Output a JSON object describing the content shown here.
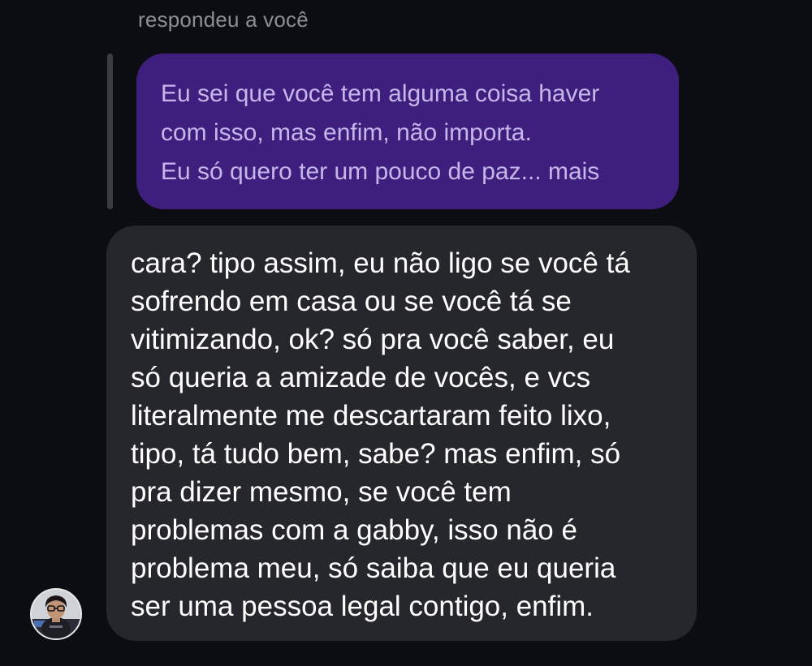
{
  "reply_context": {
    "header": "respondeu a você",
    "quoted_lines": [
      "Eu sei que você tem alguma coisa haver",
      "com isso, mas enfim, não importa.",
      "Eu só quero ter um pouco de paz... mais"
    ]
  },
  "message": {
    "lines": [
      "cara? tipo assim, eu não ligo se você tá",
      "sofrendo em casa ou se você tá se",
      "vitimizando, ok? só pra você saber, eu",
      "só queria a amizade de vocês, e vcs",
      "literalmente me descartaram feito lixo,",
      "tipo, tá tudo bem, sabe? mas enfim, só",
      "pra dizer mesmo, se você tem",
      "problemas com a gabby, isso não é",
      "problema meu, só saiba que eu queria",
      "ser uma pessoa legal contigo, enfim."
    ]
  },
  "colors": {
    "background": "#0b0d12",
    "quoted_bubble": "#3f1f7e",
    "quoted_text": "#c6b6ea",
    "message_bubble": "#25272c",
    "header_text": "#8e8f95"
  },
  "icons": {
    "avatar": "user-avatar-photo"
  }
}
